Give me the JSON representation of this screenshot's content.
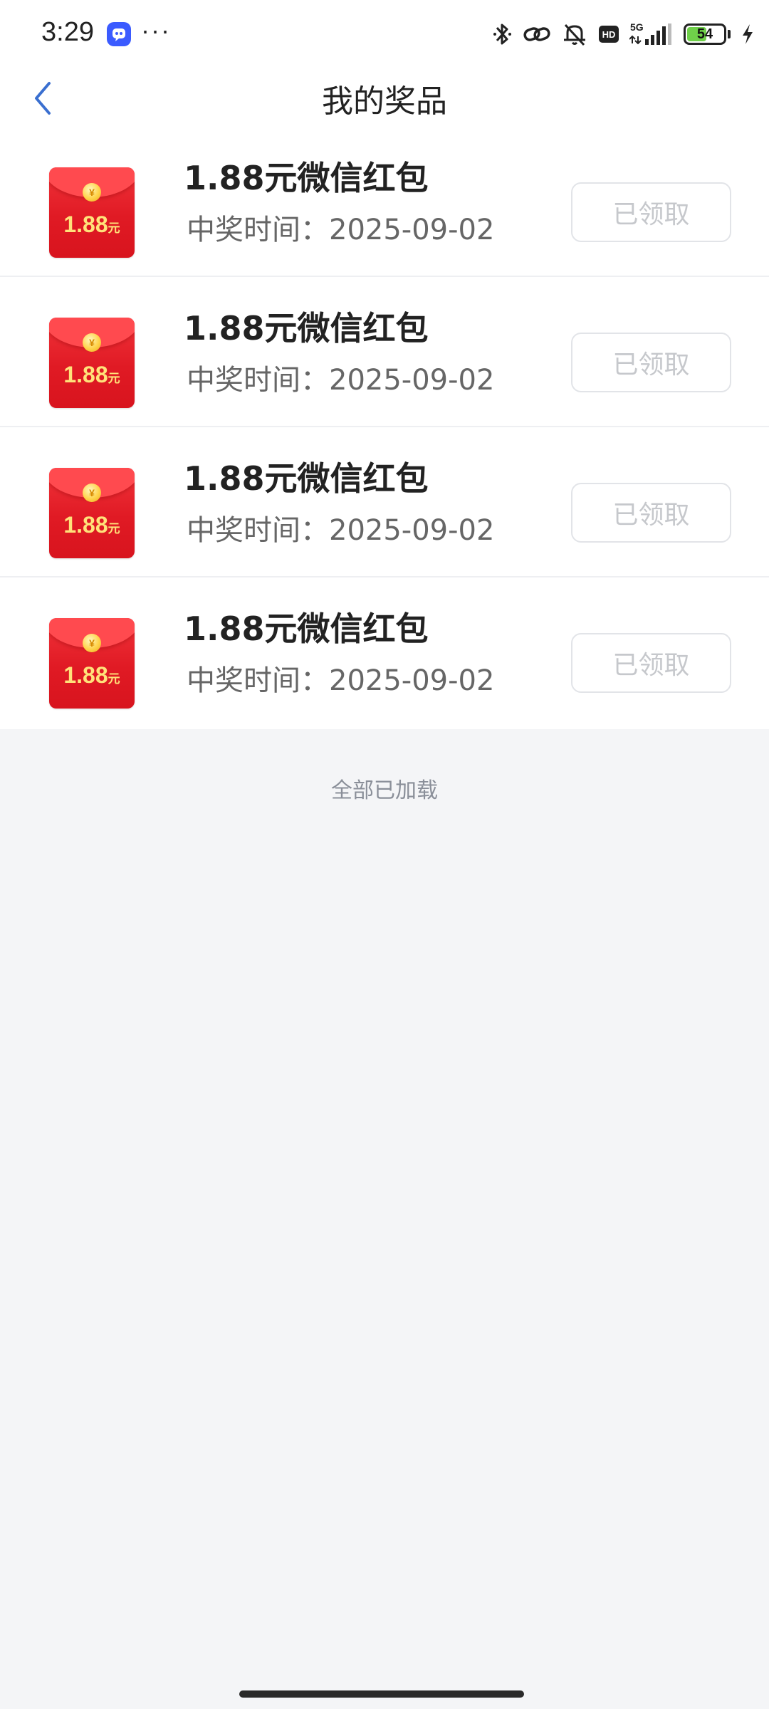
{
  "status_bar": {
    "time": "3:29",
    "more": "···",
    "network": "5G",
    "hd": "HD",
    "battery_level": "54",
    "battery_fraction": 0.54
  },
  "nav": {
    "title": "我的奖品",
    "back_icon": "chevron-left-icon"
  },
  "colors": {
    "envelope_red": "#e01a24",
    "envelope_gold": "#ffe27a",
    "back_arrow": "#3a6fd0",
    "claimed_text": "#c6c8cc"
  },
  "prizes": [
    {
      "envelope_amount": "1.88",
      "envelope_unit": "元",
      "name": "1.88元微信红包",
      "time": "中奖时间：2025-09-02",
      "status": "已领取"
    },
    {
      "envelope_amount": "1.88",
      "envelope_unit": "元",
      "name": "1.88元微信红包",
      "time": "中奖时间：2025-09-02",
      "status": "已领取"
    },
    {
      "envelope_amount": "1.88",
      "envelope_unit": "元",
      "name": "1.88元微信红包",
      "time": "中奖时间：2025-09-02",
      "status": "已领取"
    },
    {
      "envelope_amount": "1.88",
      "envelope_unit": "元",
      "name": "1.88元微信红包",
      "time": "中奖时间：2025-09-02",
      "status": "已领取"
    }
  ],
  "list_footer": "全部已加载"
}
